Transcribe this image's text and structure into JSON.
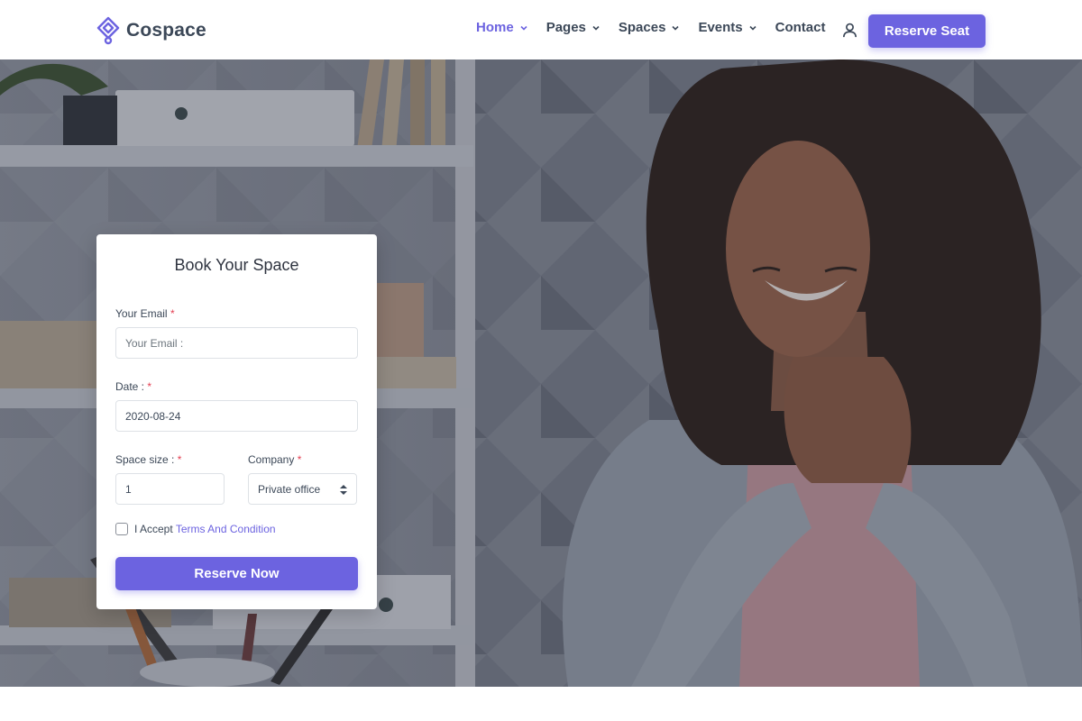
{
  "brand": {
    "name": "Cospace",
    "logo_icon": "cospace-logo-icon",
    "accent_color": "#6c63e0"
  },
  "nav": {
    "items": [
      {
        "label": "Home",
        "has_dropdown": true,
        "active": true
      },
      {
        "label": "Pages",
        "has_dropdown": true,
        "active": false
      },
      {
        "label": "Spaces",
        "has_dropdown": true,
        "active": false
      },
      {
        "label": "Events",
        "has_dropdown": true,
        "active": false
      },
      {
        "label": "Contact",
        "has_dropdown": false,
        "active": false
      }
    ],
    "user_icon": "user-icon",
    "cta_label": "Reserve Seat"
  },
  "booking": {
    "title": "Book Your Space",
    "required_mark": "*",
    "email": {
      "label": "Your Email",
      "placeholder": "Your Email :",
      "value": ""
    },
    "date": {
      "label": "Date :",
      "value": "2020-08-24"
    },
    "space_size": {
      "label": "Space size :",
      "value": "1"
    },
    "company": {
      "label": "Company",
      "selected": "Private office"
    },
    "terms": {
      "prefix": "I Accept",
      "link_text": "Terms And Condition",
      "checked": false
    },
    "submit_label": "Reserve Now"
  }
}
